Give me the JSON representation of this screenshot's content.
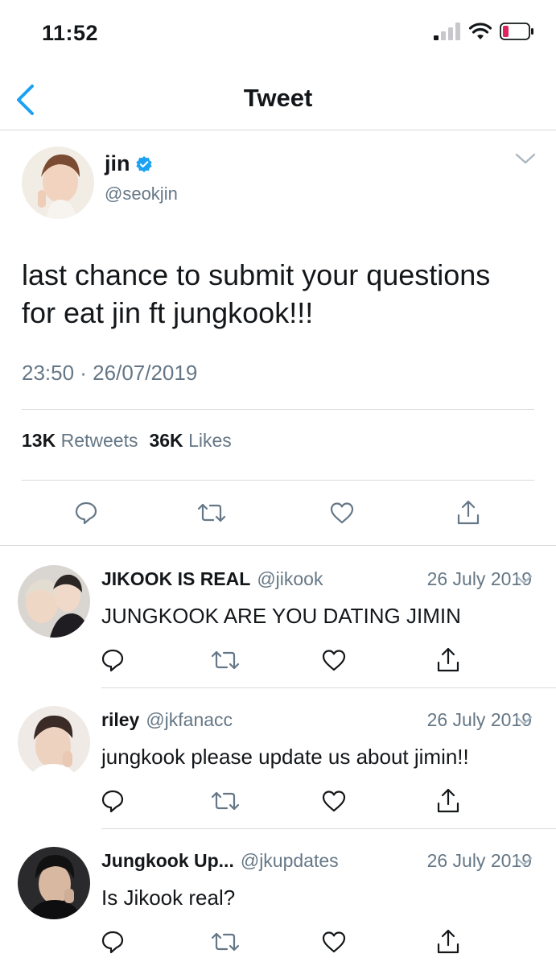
{
  "status_bar": {
    "time": "11:52"
  },
  "nav": {
    "title": "Tweet"
  },
  "main_tweet": {
    "name": "jin",
    "handle": "@seokjin",
    "text_line1": "last chance to submit your questions",
    "text_line2": "for eat jin ft jungkook!!!",
    "timestamp": "23:50 · 26/07/2019",
    "retweets_count": "13K",
    "retweets_label": "Retweets",
    "likes_count": "36K",
    "likes_label": "Likes"
  },
  "replies": [
    {
      "name": "JIKOOK IS REAL",
      "handle": "@jikook",
      "date": "26 July 2019",
      "text": "JUNGKOOK ARE YOU DATING JIMIN"
    },
    {
      "name": "riley",
      "handle": "@jkfanacc",
      "date": "26 July 2019",
      "text": "jungkook please update us about jimin!!"
    },
    {
      "name": "Jungkook Up...",
      "handle": "@jkupdates",
      "date": "26 July 2019",
      "text": "Is Jikook real?"
    }
  ],
  "colors": {
    "accent": "#1da1f2",
    "muted": "#657786",
    "icon": "#8899a6",
    "battery_low": "#e0245e"
  },
  "icons": [
    "back-chevron-icon",
    "verified-badge-icon",
    "chevron-down-icon",
    "reply-icon",
    "retweet-icon",
    "like-icon",
    "share-icon",
    "signal-icon",
    "wifi-icon",
    "battery-icon"
  ]
}
